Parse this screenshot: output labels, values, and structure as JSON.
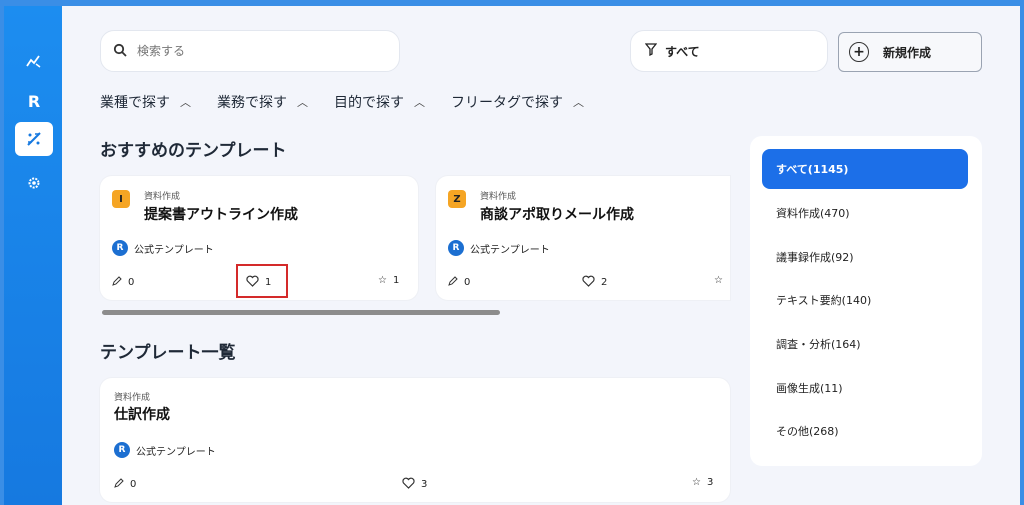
{
  "search": {
    "placeholder": "検索する"
  },
  "filter_all": {
    "label": "すべて"
  },
  "new_button": {
    "label": "新規作成"
  },
  "filters": [
    {
      "label": "業種で探す"
    },
    {
      "label": "業務で探す"
    },
    {
      "label": "目的で探す"
    },
    {
      "label": "フリータグで探す"
    }
  ],
  "recommended": {
    "title": "おすすめのテンプレート",
    "cards": [
      {
        "badge": "I",
        "category": "資料作成",
        "title": "提案書アウトライン作成",
        "official": "公式テンプレート",
        "edits": "0",
        "likes": "1",
        "stars": "1"
      },
      {
        "badge": "Z",
        "category": "資料作成",
        "title": "商談アポ取りメール作成",
        "official": "公式テンプレート",
        "edits": "0",
        "likes": "2",
        "stars": ""
      }
    ]
  },
  "list": {
    "title": "テンプレート一覧",
    "cards": [
      {
        "category": "資料作成",
        "title": "仕訳作成",
        "official": "公式テンプレート",
        "edits": "0",
        "likes": "3",
        "stars": "3"
      }
    ]
  },
  "categories": [
    {
      "label": "すべて(1145)",
      "active": true
    },
    {
      "label": "資料作成(470)"
    },
    {
      "label": "議事録作成(92)"
    },
    {
      "label": "テキスト要約(140)"
    },
    {
      "label": "調査・分析(164)"
    },
    {
      "label": "画像生成(11)"
    },
    {
      "label": "その他(268)"
    }
  ],
  "sidebar": {
    "icons": [
      "chart-icon",
      "logo-r-icon",
      "template-icon",
      "settings-icon"
    ]
  },
  "colors": {
    "sidebar": "#1679e0",
    "accent": "#1c6fe8",
    "badge": "#f5a524",
    "highlight": "#d42a2a"
  }
}
